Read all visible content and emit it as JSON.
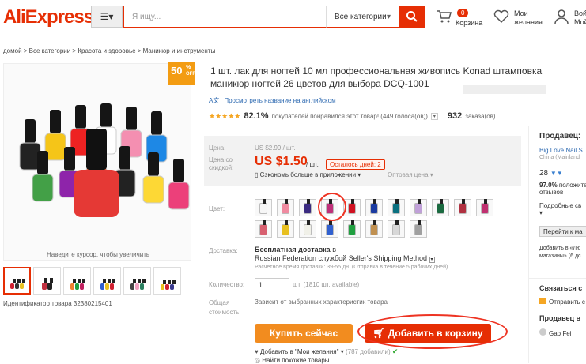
{
  "header": {
    "logo": "AliExpress",
    "search_placeholder": "Я ищу...",
    "category": "Все категории",
    "cart_count": "0",
    "cart_label": "Корзина",
    "wish_line1": "Мои",
    "wish_line2": "желания",
    "account_line1": "Вой",
    "account_line2": "Мой"
  },
  "breadcrumb": "домой > Все категории > Красота и здоровье > Маникюр и инструменты",
  "gallery": {
    "badge_num": "50",
    "badge_pct": "%",
    "badge_off": "OFF",
    "zoom_hint": "Наведите курсор, чтобы увеличить",
    "product_id": "Идентификатор товара 32380215401"
  },
  "product": {
    "title": "1 шт. лак для ногтей 10 мл профессиональная живопись Konad штамповка маникюр ногтей 26 цветов для выбора DCQ-1001",
    "translate_link": "Просмотреть название на английском",
    "stars": "★★★★★",
    "rating_pct": "82.1%",
    "rating_text": "покупателей понравился этот товар! (449 голоса(ов))",
    "orders": "932",
    "orders_label": "заказа(ов)"
  },
  "price": {
    "label": "Цена:",
    "old": "US $2.99 / шт.",
    "discount_label1": "Цена со",
    "discount_label2": "скидкой:",
    "value": "US $1.50",
    "unit": "/ шт.",
    "days_left": "Осталось дней: 2",
    "app_save": "Сэкономь больше в приложении",
    "wholesale": "Оптовая цена"
  },
  "color": {
    "label": "Цвет:",
    "swatches": [
      "#f6f6f6",
      "#f08aa0",
      "#3a2a80",
      "#c0307a",
      "#d01020",
      "#1a3aa0",
      "#0a7080",
      "#c0a0d8",
      "#1a6a40",
      "#b03040",
      "#c03070",
      "#d86070",
      "#e8c020",
      "#f0f0e8",
      "#3060d0",
      "#20a040",
      "#c09050",
      "#d8d8d8",
      "#a0a0a0"
    ]
  },
  "shipping": {
    "label": "Доставка:",
    "free": "Бесплатная доставка",
    "to": "в",
    "method": "Russian Federation службой Seller's Shipping Method",
    "estimate": "Расчётное время доставки: 39-55 дн. (Отправка в течение 5 рабочих дней)"
  },
  "quantity": {
    "label": "Количество:",
    "value": "1",
    "available": "шт. (1810 шт. available)"
  },
  "total": {
    "label1": "Общая",
    "label2": "стоимость:",
    "text": "Зависит от выбранных характеристик товара"
  },
  "actions": {
    "buy_now": "Купить сейчас",
    "add_to_cart": "Добавить в корзину",
    "wishlist": "Добавить в \"Мои желания\"",
    "wish_count": "(787 добавили)",
    "similar": "Найти похожие товары"
  },
  "seller": {
    "heading": "Продавец:",
    "name": "Big Love Nail S",
    "country": "China (Mainland",
    "score": "28",
    "positive": "97.0%",
    "positive_text1": "положительных",
    "positive_text2": "отзывов",
    "details": "Подробные св",
    "go_to": "Перейти к ма",
    "add_fav1": "Добавить в «Лю",
    "add_fav2": "магазины» (6 дс",
    "contact": "Связаться с",
    "send": "Отправить с",
    "seller_heading": "Продавец в",
    "seller_name": "Gao Fei"
  }
}
